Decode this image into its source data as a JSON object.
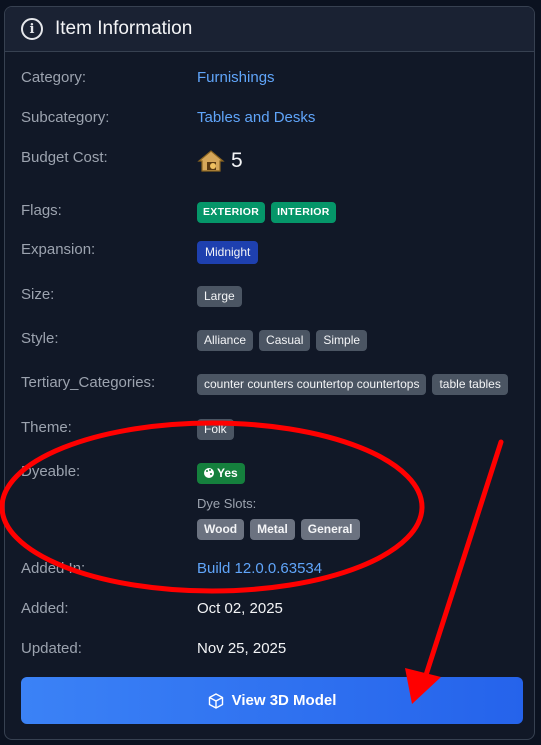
{
  "header": {
    "title": "Item Information",
    "icon": "info-icon"
  },
  "rows": {
    "category": {
      "label": "Category:",
      "value": "Furnishings"
    },
    "subcategory": {
      "label": "Subcategory:",
      "value": "Tables and Desks"
    },
    "budget": {
      "label": "Budget Cost:",
      "value": "5",
      "icon": "house-budget-icon"
    },
    "flags": {
      "label": "Flags:",
      "badges": [
        "EXTERIOR",
        "INTERIOR"
      ]
    },
    "expansion": {
      "label": "Expansion:",
      "value": "Midnight"
    },
    "size": {
      "label": "Size:",
      "value": "Large"
    },
    "style": {
      "label": "Style:",
      "badges": [
        "Alliance",
        "Casual",
        "Simple"
      ]
    },
    "tertiary": {
      "label": "Tertiary_Categories:",
      "badges": [
        "counter counters countertop countertops",
        "table tables"
      ]
    },
    "theme": {
      "label": "Theme:",
      "value": "Folk"
    },
    "dyeable": {
      "label": "Dyeable:",
      "value": "Yes",
      "icon": "palette-icon",
      "slots_label": "Dye Slots:",
      "slots": [
        "Wood",
        "Metal",
        "General"
      ]
    },
    "added_in": {
      "label": "Added In:",
      "value": "Build 12.0.0.63534"
    },
    "added": {
      "label": "Added:",
      "value": "Oct 02, 2025"
    },
    "updated": {
      "label": "Updated:",
      "value": "Nov 25, 2025"
    }
  },
  "button": {
    "label": "View 3D Model",
    "icon": "cube-icon"
  },
  "colors": {
    "accent": "#3b82f6",
    "annotation": "#ff0000"
  }
}
